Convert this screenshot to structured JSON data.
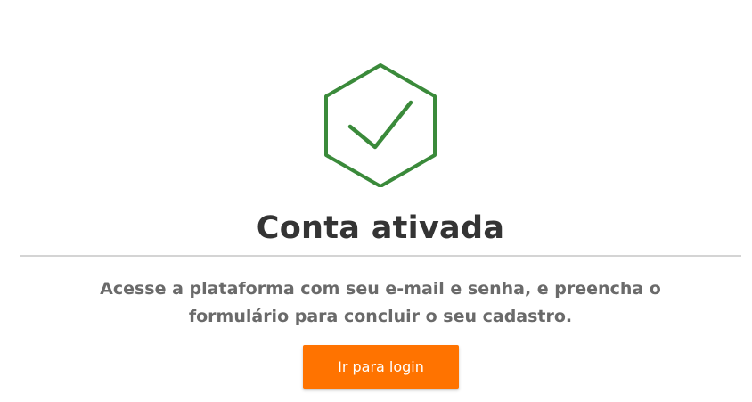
{
  "icon": {
    "name": "hexagon-check-icon",
    "color": "#3a8a3a"
  },
  "title": "Conta ativada",
  "message": {
    "line1": "Acesse a plataforma com seu e-mail e senha, e preencha o",
    "line2": "formulário para concluir o seu cadastro."
  },
  "button": {
    "label": "Ir para login",
    "color": "#ff7300"
  }
}
